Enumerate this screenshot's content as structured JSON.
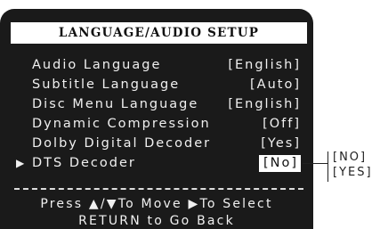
{
  "title": "LANGUAGE/AUDIO SETUP",
  "items": [
    {
      "label": "Audio Language",
      "value": "[English]",
      "selected": false
    },
    {
      "label": "Subtitle Language",
      "value": "[Auto]",
      "selected": false
    },
    {
      "label": "Disc Menu Language",
      "value": "[English]",
      "selected": false
    },
    {
      "label": "Dynamic Compression",
      "value": "[Off]",
      "selected": false
    },
    {
      "label": "Dolby Digital Decoder",
      "value": "[Yes]",
      "selected": false
    },
    {
      "label": "DTS Decoder",
      "value": "[No]",
      "selected": true
    }
  ],
  "pointer_glyph": "▶",
  "footer": {
    "line1": "Press ▲/▼To Move ▶To Select",
    "line2": "RETURN to Go Back"
  },
  "options": [
    "[NO]",
    "[YES]"
  ],
  "colors": {
    "background": "#1a1a1a",
    "text": "#f0f0f0",
    "highlight": "#ffffff"
  }
}
